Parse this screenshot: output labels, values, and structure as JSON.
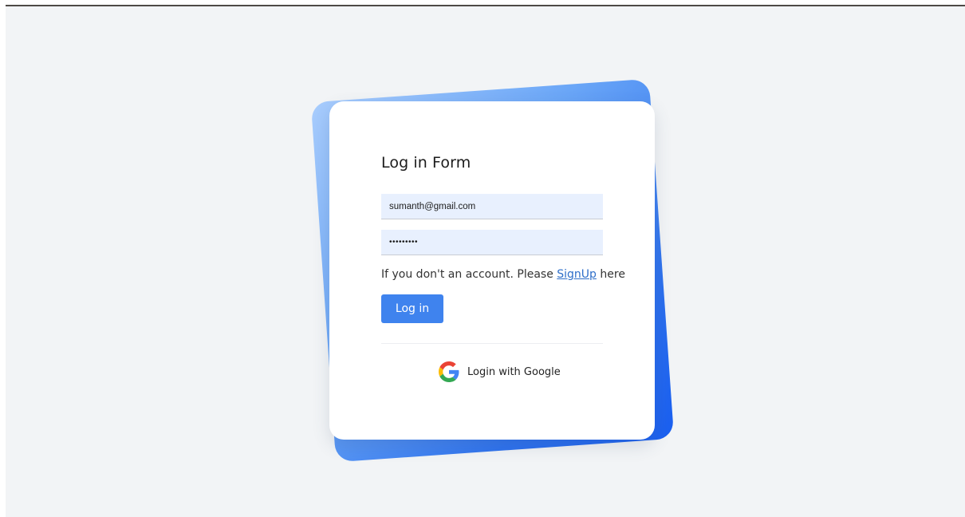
{
  "form": {
    "title": "Log in Form",
    "email_value": "sumanth@gmail.com",
    "password_value": "•••••••••",
    "signup_prefix": "If you don't an account. Please ",
    "signup_link": "SignUp",
    "signup_suffix": " here",
    "login_label": "Log in",
    "google_label": "Login with Google"
  },
  "icons": {
    "google": "google-g-icon"
  },
  "colors": {
    "background": "#f2f4f6",
    "card": "#ffffff",
    "accent": "#3f83ee",
    "input_fill": "#e8f0fe",
    "link": "#2f6fc9"
  }
}
